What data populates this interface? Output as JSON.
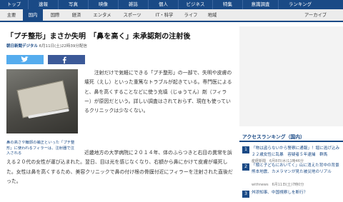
{
  "topnav": {
    "items": [
      "トップ",
      "速報",
      "写真",
      "映像",
      "雑誌",
      "個人",
      "ビジネス",
      "特集",
      "意識調査",
      "ランキング"
    ]
  },
  "subnav": {
    "items": [
      "主要",
      "国内",
      "国際",
      "経済",
      "エンタメ",
      "スポーツ",
      "IT・科学",
      "ライフ",
      "地域"
    ],
    "active": "国内",
    "archive": "アーカイブ"
  },
  "article": {
    "headline": "「プチ整形」まさか失明　「鼻を高く」未承認剤の注射後",
    "source": "朝日新聞デジタル",
    "date": "6月11日(土)22時39分配信",
    "photo_caption": "鼻の高さや輪郭の補正といった「プチ整形」に使われるフィラーは、注射器で注入される",
    "paragraph1": "注射だけで気軽にできる「プチ整形」の一部で、失明や皮膚の壊死（えし）といった重篤なトラブルが起きている。専門医によると、鼻を高くすることなどに使う充填（じゅうてん）剤（フィラー）が原因だという。詳しい調査はされておらず、現在も使っているクリニックは少なくない。",
    "paragraph2_lead": "近畿地方の大学病院に２０１４年、体のふらつきと右目の異常を訴える２０代の女性が運び込まれた。翌日、目は光を感じなくなり、右額から鼻にかけて皮膚が壊死した。女性は鼻を高くするため、美容クリニックで鼻の付け根の骨膜付近にフィラーを注射された直後だった。"
  },
  "ranking": {
    "title": "アクセスランキング（国内）",
    "items": [
      {
        "no": "1",
        "text": "「物は盗らないから警察に通報」！堀に逃げ込み２２歳女性に乱暴　容疑者５年逮捕　群馬",
        "meta": "産経新聞　6月8日(水)11時46分"
      },
      {
        "no": "2",
        "text": "「頭と子どもにおいてく」山に消えた背中の背景　熊本地震、カメラマンが見た被災地のリアル",
        "meta": "withnews　6月11日(土)7時0分"
      },
      {
        "no": "3",
        "text": "舛添知事、中国視察しを断行？",
        "meta": ""
      }
    ]
  },
  "share": {
    "twitter_icon": "twitter-icon",
    "facebook_icon": "facebook-icon"
  },
  "colors": {
    "brand": "#1a4a86",
    "twitter": "#55acee",
    "facebook": "#3b5998"
  }
}
